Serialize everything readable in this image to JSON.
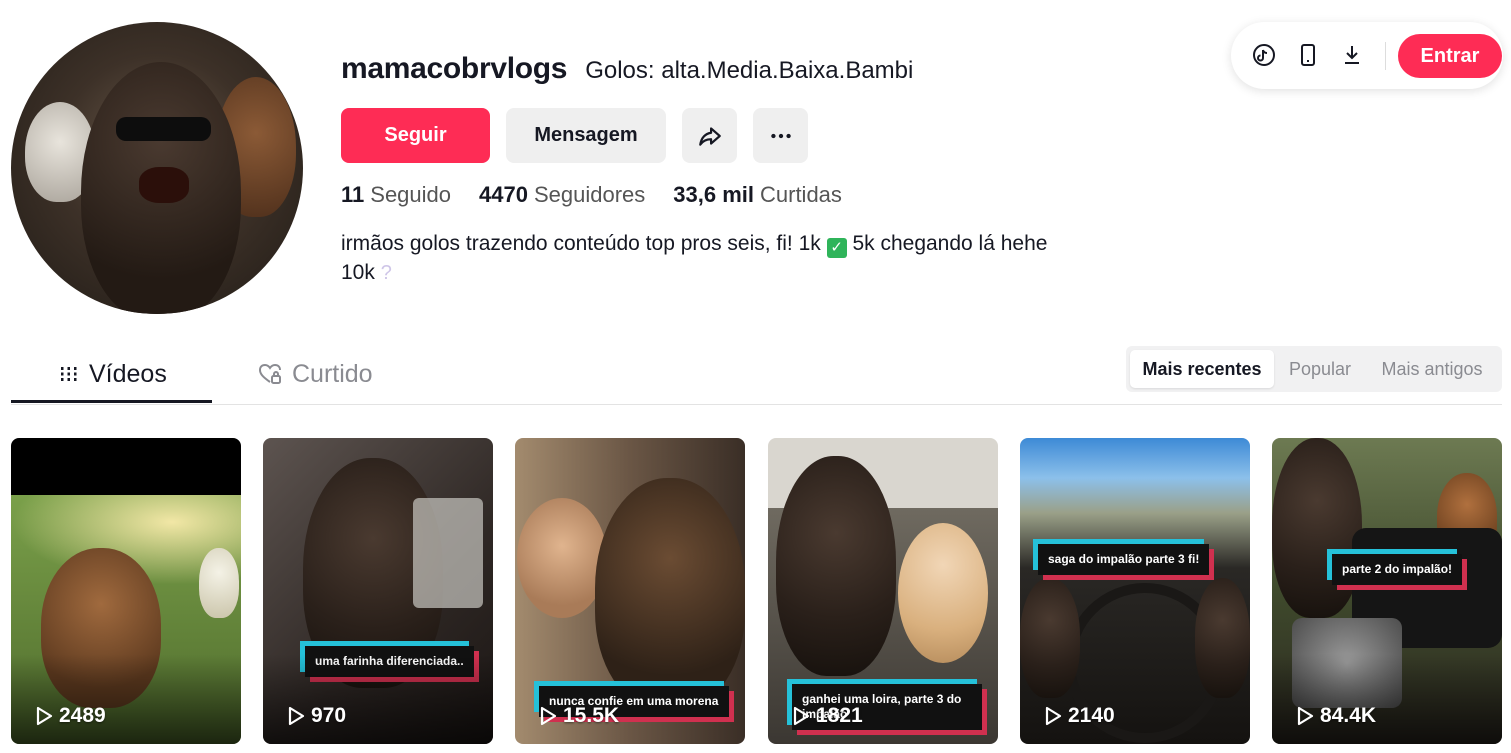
{
  "profile": {
    "username": "mamacobrvlogs",
    "nickname": "Golos: alta.Media.Baixa.Bambi",
    "follow_label": "Seguir",
    "message_label": "Mensagem",
    "share_icon": "share-icon",
    "more_icon": "more-icon",
    "bio_line1_a": "irmãos golos trazendo conteúdo top pros seis, fi! 1k",
    "bio_check": "✓",
    "bio_line1_b": "5k chegando lá hehe",
    "bio_line2": "10k",
    "bio_q": "?"
  },
  "stats": {
    "following_count": "11",
    "following_label": "Seguido",
    "followers_count": "4470",
    "followers_label": "Seguidores",
    "likes_count": "33,6 mil",
    "likes_label": "Curtidas"
  },
  "topbar": {
    "login_label": "Entrar"
  },
  "tabs": {
    "videos": "Vídeos",
    "liked": "Curtido"
  },
  "sort": {
    "recent": "Mais recentes",
    "popular": "Popular",
    "oldest": "Mais antigos",
    "selected": "Mais recentes"
  },
  "videos": [
    {
      "views": "2489",
      "caption": ""
    },
    {
      "views": "970",
      "caption": "uma farinha diferenciada.."
    },
    {
      "views": "15.5K",
      "caption": "nunca confie em uma morena"
    },
    {
      "views": "1821",
      "caption": "ganhei uma loira, parte 3 do impalão"
    },
    {
      "views": "2140",
      "caption": "saga do impalão parte 3 fi!"
    },
    {
      "views": "84.4K",
      "caption": "parte 2 do impalão!"
    }
  ],
  "colors": {
    "accent": "#fe2c55",
    "text": "#161823",
    "muted": "#8a8b91",
    "caption_cyan": "#25c1d9",
    "caption_red": "#d0304f"
  }
}
